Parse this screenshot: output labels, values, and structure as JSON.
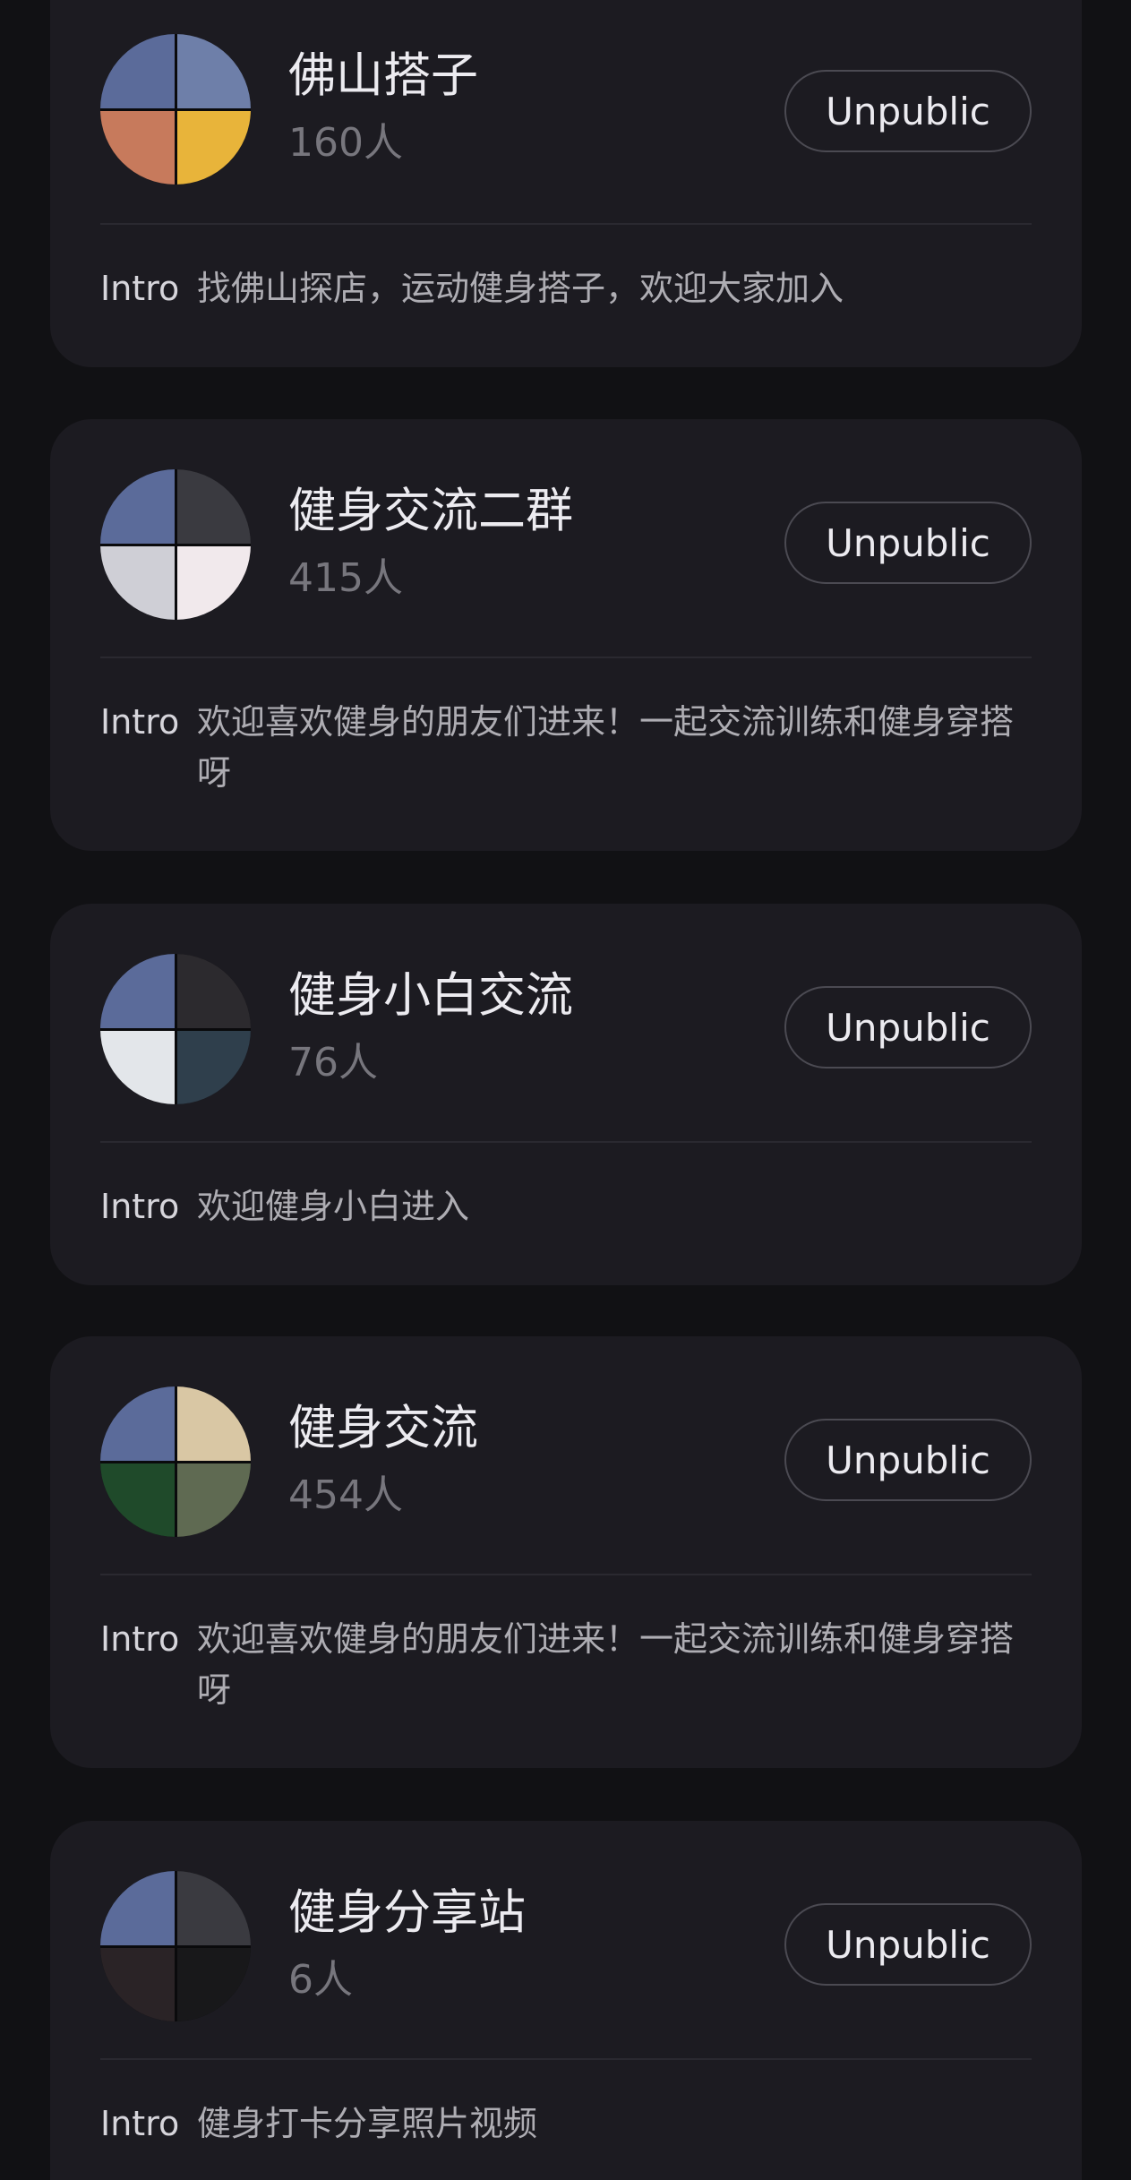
{
  "groups": [
    {
      "name": "佛山搭子",
      "count": "160人",
      "button_label": "Unpublic",
      "intro_label": "Intro",
      "intro": "找佛山探店，运动健身搭子，欢迎大家加入",
      "avatar_tile_colors": [
        "#5b6b9a",
        "#6e7fa9",
        "#c77a5c",
        "#e8b43a"
      ]
    },
    {
      "name": "健身交流二群",
      "count": "415人",
      "button_label": "Unpublic",
      "intro_label": "Intro",
      "intro": "欢迎喜欢健身的朋友们进来！一起交流训练和健身穿搭呀",
      "avatar_tile_colors": [
        "#5b6b9a",
        "#3a3a40",
        "#cfcfd6",
        "#f1e9ec"
      ]
    },
    {
      "name": "健身小白交流",
      "count": "76人",
      "button_label": "Unpublic",
      "intro_label": "Intro",
      "intro": "欢迎健身小白进入",
      "avatar_tile_colors": [
        "#5b6b9a",
        "#2c2a2e",
        "#e3e6ea",
        "#2f3f4c"
      ]
    },
    {
      "name": "健身交流",
      "count": "454人",
      "button_label": "Unpublic",
      "intro_label": "Intro",
      "intro": "欢迎喜欢健身的朋友们进来！一起交流训练和健身穿搭呀",
      "avatar_tile_colors": [
        "#5b6b9a",
        "#d9c7a4",
        "#1f4a2a",
        "#5f6a52"
      ]
    },
    {
      "name": "健身分享站",
      "count": "6人",
      "button_label": "Unpublic",
      "intro_label": "Intro",
      "intro": "健身打卡分享照片视频",
      "avatar_tile_colors": [
        "#5b6b9a",
        "#3a3a40",
        "#2a2326",
        "#18181a"
      ]
    }
  ],
  "colors": {
    "page_background": "#111114",
    "card_background": "#1c1b21",
    "title_text": "#ecebf0",
    "muted_text": "#77767d",
    "button_border": "#4b4a52"
  }
}
